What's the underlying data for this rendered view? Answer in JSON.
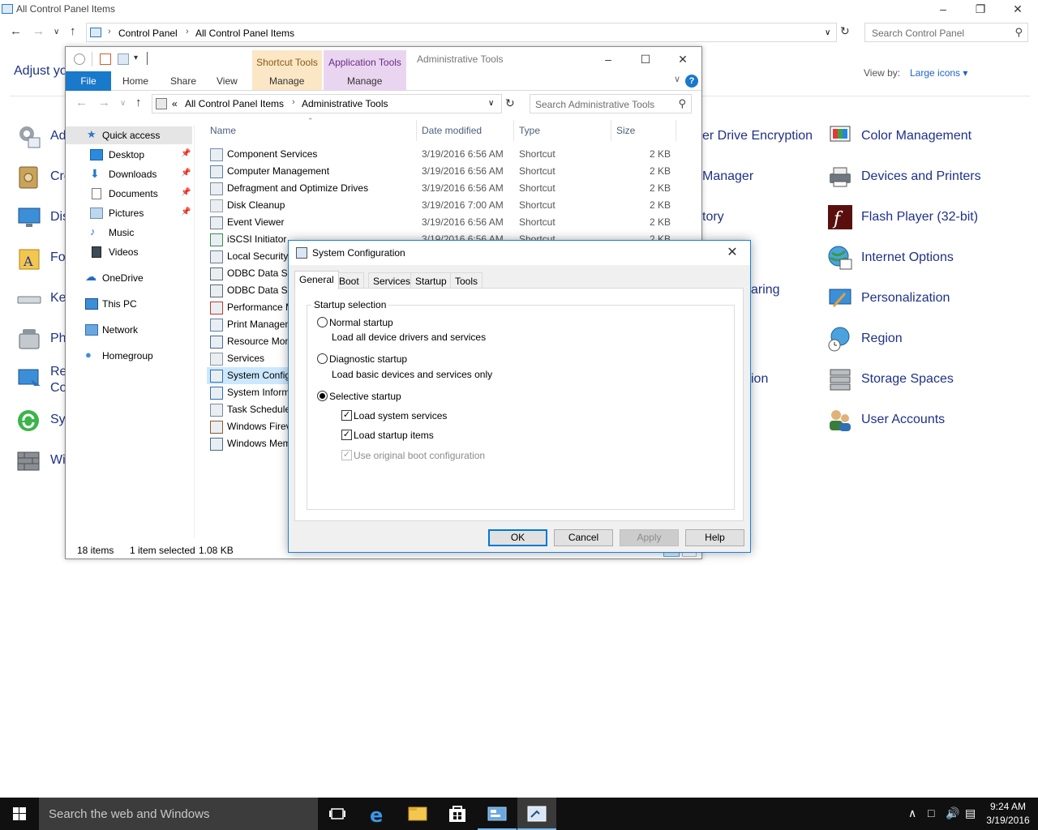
{
  "control_panel": {
    "title": "All Control Panel Items",
    "breadcrumb": [
      "Control Panel",
      "All Control Panel Items"
    ],
    "search_placeholder": "Search Control Panel",
    "heading": "Adjust yo",
    "view_by_label": "View by:",
    "view_by_value": "Large icons",
    "left_items": [
      "Ad",
      "Cre",
      "Dis",
      "Fo",
      "Ke",
      "Ph",
      "Re",
      "Co",
      "Sy",
      "Wi"
    ],
    "middle_items": [
      "er Drive Encryption",
      "Manager",
      "tory",
      "aring",
      "ion"
    ],
    "right_items": [
      "Color Management",
      "Devices and Printers",
      "Flash Player (32-bit)",
      "Internet Options",
      "Personalization",
      "Region",
      "Storage Spaces",
      "User Accounts"
    ]
  },
  "explorer": {
    "context_tab_shortcut": "Shortcut Tools",
    "context_tab_app": "Application Tools",
    "window_title": "Administrative Tools",
    "ribbon_tabs": {
      "file": "File",
      "home": "Home",
      "share": "Share",
      "view": "View",
      "manage1": "Manage",
      "manage2": "Manage"
    },
    "breadcrumb": [
      "«",
      "All Control Panel Items",
      "Administrative Tools"
    ],
    "search_placeholder": "Search Administrative Tools",
    "nav": {
      "quick_access": "Quick access",
      "desktop": "Desktop",
      "downloads": "Downloads",
      "documents": "Documents",
      "pictures": "Pictures",
      "music": "Music",
      "videos": "Videos",
      "onedrive": "OneDrive",
      "this_pc": "This PC",
      "network": "Network",
      "homegroup": "Homegroup"
    },
    "columns": {
      "name": "Name",
      "date": "Date modified",
      "type": "Type",
      "size": "Size"
    },
    "files": [
      {
        "name": "Component Services",
        "date": "3/19/2016 6:56 AM",
        "type": "Shortcut",
        "size": "2 KB"
      },
      {
        "name": "Computer Management",
        "date": "3/19/2016 6:56 AM",
        "type": "Shortcut",
        "size": "2 KB"
      },
      {
        "name": "Defragment and Optimize Drives",
        "date": "3/19/2016 6:56 AM",
        "type": "Shortcut",
        "size": "2 KB"
      },
      {
        "name": "Disk Cleanup",
        "date": "3/19/2016 7:00 AM",
        "type": "Shortcut",
        "size": "2 KB"
      },
      {
        "name": "Event Viewer",
        "date": "3/19/2016 6:56 AM",
        "type": "Shortcut",
        "size": "2 KB"
      },
      {
        "name": "iSCSI Initiator",
        "date": "3/19/2016 6:56 AM",
        "type": "Shortcut",
        "size": "2 KB"
      },
      {
        "name": "Local Security",
        "date": "",
        "type": "",
        "size": ""
      },
      {
        "name": "ODBC Data So",
        "date": "",
        "type": "",
        "size": ""
      },
      {
        "name": "ODBC Data So",
        "date": "",
        "type": "",
        "size": ""
      },
      {
        "name": "Performance M",
        "date": "",
        "type": "",
        "size": ""
      },
      {
        "name": "Print Managen",
        "date": "",
        "type": "",
        "size": ""
      },
      {
        "name": "Resource Mon",
        "date": "",
        "type": "",
        "size": ""
      },
      {
        "name": "Services",
        "date": "",
        "type": "",
        "size": ""
      },
      {
        "name": "System Config",
        "date": "",
        "type": "",
        "size": ""
      },
      {
        "name": "System Inform",
        "date": "",
        "type": "",
        "size": ""
      },
      {
        "name": "Task Scheduler",
        "date": "",
        "type": "",
        "size": ""
      },
      {
        "name": "Windows Firev",
        "date": "",
        "type": "",
        "size": ""
      },
      {
        "name": "Windows Mem",
        "date": "",
        "type": "",
        "size": ""
      }
    ],
    "status": {
      "count": "18 items",
      "selected": "1 item selected",
      "size": "1.08 KB"
    }
  },
  "msconfig": {
    "title": "System Configuration",
    "tabs": [
      "General",
      "Boot",
      "Services",
      "Startup",
      "Tools"
    ],
    "group_label": "Startup selection",
    "normal_startup": "Normal startup",
    "normal_desc": "Load all device drivers and services",
    "diagnostic_startup": "Diagnostic startup",
    "diagnostic_desc": "Load basic devices and services only",
    "selective_startup": "Selective startup",
    "load_system_services": "Load system services",
    "load_startup_items": "Load startup items",
    "use_original_boot": "Use original boot configuration",
    "buttons": {
      "ok": "OK",
      "cancel": "Cancel",
      "apply": "Apply",
      "help": "Help"
    }
  },
  "taskbar": {
    "search_placeholder": "Search the web and Windows",
    "time": "9:24 AM",
    "date": "3/19/2016"
  },
  "colors": {
    "accent": "#1979ca",
    "taskbar": "#101010",
    "link": "#1e3287",
    "selection": "#cce8ff"
  }
}
